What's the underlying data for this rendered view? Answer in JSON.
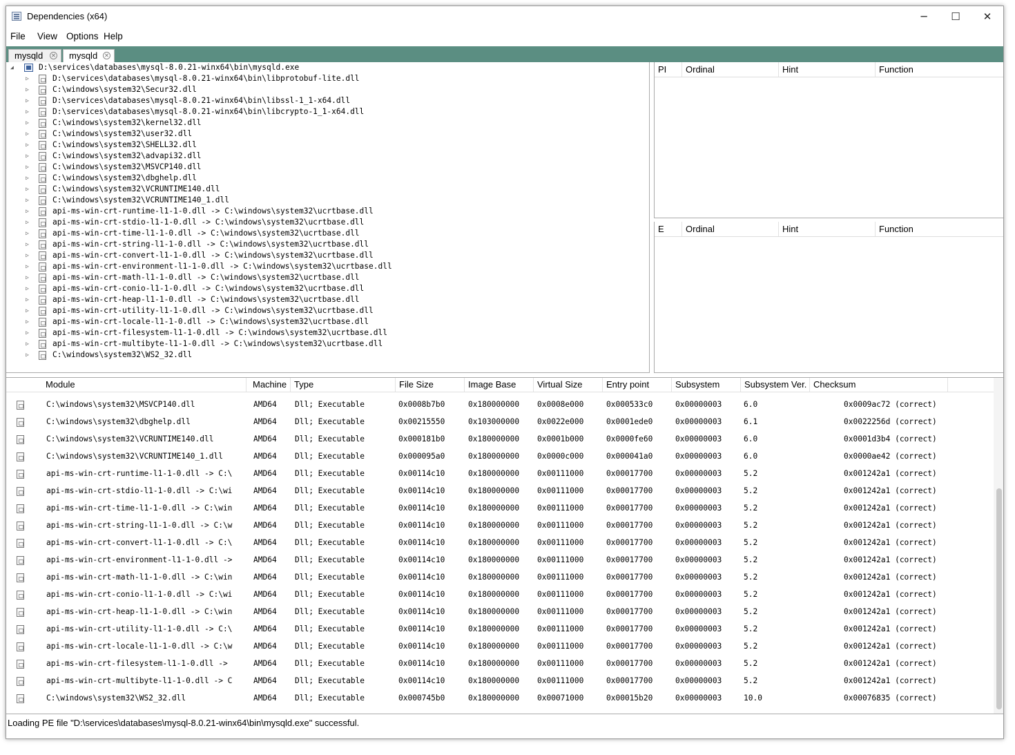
{
  "window": {
    "title": "Dependencies (x64)",
    "minimize": "─",
    "maximize": "☐",
    "close": "✕"
  },
  "menu": [
    "File",
    "View",
    "Options",
    "Help"
  ],
  "tabs": [
    {
      "label": "mysqld"
    },
    {
      "label": "mysqld"
    }
  ],
  "tree": {
    "root": "D:\\services\\databases\\mysql-8.0.21-winx64\\bin\\mysqld.exe",
    "children": [
      "D:\\services\\databases\\mysql-8.0.21-winx64\\bin\\libprotobuf-lite.dll",
      "C:\\windows\\system32\\Secur32.dll",
      "D:\\services\\databases\\mysql-8.0.21-winx64\\bin\\libssl-1_1-x64.dll",
      "D:\\services\\databases\\mysql-8.0.21-winx64\\bin\\libcrypto-1_1-x64.dll",
      "C:\\windows\\system32\\kernel32.dll",
      "C:\\windows\\system32\\user32.dll",
      "C:\\windows\\system32\\SHELL32.dll",
      "C:\\windows\\system32\\advapi32.dll",
      "C:\\windows\\system32\\MSVCP140.dll",
      "C:\\windows\\system32\\dbghelp.dll",
      "C:\\windows\\system32\\VCRUNTIME140.dll",
      "C:\\windows\\system32\\VCRUNTIME140_1.dll",
      "api-ms-win-crt-runtime-l1-1-0.dll -> C:\\windows\\system32\\ucrtbase.dll",
      "api-ms-win-crt-stdio-l1-1-0.dll -> C:\\windows\\system32\\ucrtbase.dll",
      "api-ms-win-crt-time-l1-1-0.dll -> C:\\windows\\system32\\ucrtbase.dll",
      "api-ms-win-crt-string-l1-1-0.dll -> C:\\windows\\system32\\ucrtbase.dll",
      "api-ms-win-crt-convert-l1-1-0.dll -> C:\\windows\\system32\\ucrtbase.dll",
      "api-ms-win-crt-environment-l1-1-0.dll -> C:\\windows\\system32\\ucrtbase.dll",
      "api-ms-win-crt-math-l1-1-0.dll -> C:\\windows\\system32\\ucrtbase.dll",
      "api-ms-win-crt-conio-l1-1-0.dll -> C:\\windows\\system32\\ucrtbase.dll",
      "api-ms-win-crt-heap-l1-1-0.dll -> C:\\windows\\system32\\ucrtbase.dll",
      "api-ms-win-crt-utility-l1-1-0.dll -> C:\\windows\\system32\\ucrtbase.dll",
      "api-ms-win-crt-locale-l1-1-0.dll -> C:\\windows\\system32\\ucrtbase.dll",
      "api-ms-win-crt-filesystem-l1-1-0.dll -> C:\\windows\\system32\\ucrtbase.dll",
      "api-ms-win-crt-multibyte-l1-1-0.dll -> C:\\windows\\system32\\ucrtbase.dll",
      "C:\\windows\\system32\\WS2_32.dll"
    ]
  },
  "imports_table": {
    "headers": [
      "PI",
      "Ordinal",
      "Hint",
      "Function"
    ]
  },
  "exports_table": {
    "headers": [
      "E",
      "Ordinal",
      "Hint",
      "Function"
    ]
  },
  "modules": {
    "headers": [
      "Module",
      "Machine",
      "Type",
      "File Size",
      "Image Base",
      "Virtual Size",
      "Entry point",
      "Subsystem",
      "Subsystem Ver.",
      "Checksum"
    ],
    "rows": [
      [
        "C:\\windows\\system32\\MSVCP140.dll",
        "AMD64",
        "Dll; Executable",
        "0x0008b7b0",
        "0x180000000",
        "0x0008e000",
        "0x000533c0",
        "0x00000003",
        "6.0",
        "0x0009ac72 (correct)"
      ],
      [
        "C:\\windows\\system32\\dbghelp.dll",
        "AMD64",
        "Dll; Executable",
        "0x00215550",
        "0x103000000",
        "0x0022e000",
        "0x0001ede0",
        "0x00000003",
        "6.1",
        "0x0022256d (correct)"
      ],
      [
        "C:\\windows\\system32\\VCRUNTIME140.dll",
        "AMD64",
        "Dll; Executable",
        "0x000181b0",
        "0x180000000",
        "0x0001b000",
        "0x0000fe60",
        "0x00000003",
        "6.0",
        "0x0001d3b4 (correct)"
      ],
      [
        "C:\\windows\\system32\\VCRUNTIME140_1.dll",
        "AMD64",
        "Dll; Executable",
        "0x000095a0",
        "0x180000000",
        "0x0000c000",
        "0x000041a0",
        "0x00000003",
        "6.0",
        "0x0000ae42 (correct)"
      ],
      [
        "api-ms-win-crt-runtime-l1-1-0.dll -> C:\\",
        "AMD64",
        "Dll; Executable",
        "0x00114c10",
        "0x180000000",
        "0x00111000",
        "0x00017700",
        "0x00000003",
        "5.2",
        "0x001242a1 (correct)"
      ],
      [
        "api-ms-win-crt-stdio-l1-1-0.dll -> C:\\wi",
        "AMD64",
        "Dll; Executable",
        "0x00114c10",
        "0x180000000",
        "0x00111000",
        "0x00017700",
        "0x00000003",
        "5.2",
        "0x001242a1 (correct)"
      ],
      [
        "api-ms-win-crt-time-l1-1-0.dll -> C:\\win",
        "AMD64",
        "Dll; Executable",
        "0x00114c10",
        "0x180000000",
        "0x00111000",
        "0x00017700",
        "0x00000003",
        "5.2",
        "0x001242a1 (correct)"
      ],
      [
        "api-ms-win-crt-string-l1-1-0.dll -> C:\\w",
        "AMD64",
        "Dll; Executable",
        "0x00114c10",
        "0x180000000",
        "0x00111000",
        "0x00017700",
        "0x00000003",
        "5.2",
        "0x001242a1 (correct)"
      ],
      [
        "api-ms-win-crt-convert-l1-1-0.dll -> C:\\",
        "AMD64",
        "Dll; Executable",
        "0x00114c10",
        "0x180000000",
        "0x00111000",
        "0x00017700",
        "0x00000003",
        "5.2",
        "0x001242a1 (correct)"
      ],
      [
        "api-ms-win-crt-environment-l1-1-0.dll ->",
        "AMD64",
        "Dll; Executable",
        "0x00114c10",
        "0x180000000",
        "0x00111000",
        "0x00017700",
        "0x00000003",
        "5.2",
        "0x001242a1 (correct)"
      ],
      [
        "api-ms-win-crt-math-l1-1-0.dll -> C:\\win",
        "AMD64",
        "Dll; Executable",
        "0x00114c10",
        "0x180000000",
        "0x00111000",
        "0x00017700",
        "0x00000003",
        "5.2",
        "0x001242a1 (correct)"
      ],
      [
        "api-ms-win-crt-conio-l1-1-0.dll -> C:\\wi",
        "AMD64",
        "Dll; Executable",
        "0x00114c10",
        "0x180000000",
        "0x00111000",
        "0x00017700",
        "0x00000003",
        "5.2",
        "0x001242a1 (correct)"
      ],
      [
        "api-ms-win-crt-heap-l1-1-0.dll -> C:\\win",
        "AMD64",
        "Dll; Executable",
        "0x00114c10",
        "0x180000000",
        "0x00111000",
        "0x00017700",
        "0x00000003",
        "5.2",
        "0x001242a1 (correct)"
      ],
      [
        "api-ms-win-crt-utility-l1-1-0.dll -> C:\\",
        "AMD64",
        "Dll; Executable",
        "0x00114c10",
        "0x180000000",
        "0x00111000",
        "0x00017700",
        "0x00000003",
        "5.2",
        "0x001242a1 (correct)"
      ],
      [
        "api-ms-win-crt-locale-l1-1-0.dll -> C:\\w",
        "AMD64",
        "Dll; Executable",
        "0x00114c10",
        "0x180000000",
        "0x00111000",
        "0x00017700",
        "0x00000003",
        "5.2",
        "0x001242a1 (correct)"
      ],
      [
        "api-ms-win-crt-filesystem-l1-1-0.dll ->",
        "AMD64",
        "Dll; Executable",
        "0x00114c10",
        "0x180000000",
        "0x00111000",
        "0x00017700",
        "0x00000003",
        "5.2",
        "0x001242a1 (correct)"
      ],
      [
        "api-ms-win-crt-multibyte-l1-1-0.dll -> C",
        "AMD64",
        "Dll; Executable",
        "0x00114c10",
        "0x180000000",
        "0x00111000",
        "0x00017700",
        "0x00000003",
        "5.2",
        "0x001242a1 (correct)"
      ],
      [
        "C:\\windows\\system32\\WS2_32.dll",
        "AMD64",
        "Dll; Executable",
        "0x000745b0",
        "0x180000000",
        "0x00071000",
        "0x00015b20",
        "0x00000003",
        "10.0",
        "0x00076835 (correct)"
      ]
    ]
  },
  "status": "Loading PE file \"D:\\services\\databases\\mysql-8.0.21-winx64\\bin\\mysqld.exe\" successful."
}
